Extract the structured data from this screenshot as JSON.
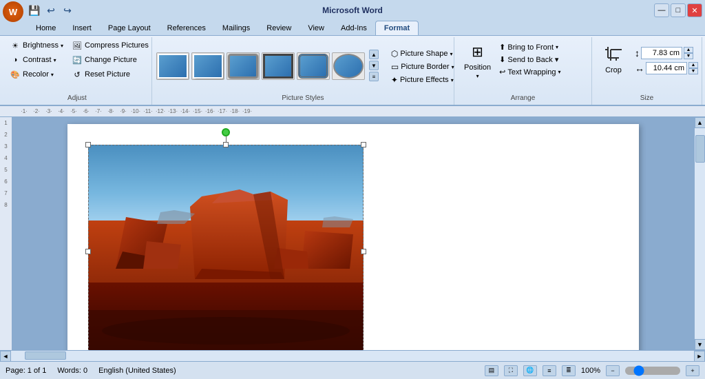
{
  "window": {
    "title": "Microsoft Word",
    "office_btn_label": "W"
  },
  "quick_access": {
    "save_label": "💾",
    "undo_label": "↩",
    "redo_label": "↪"
  },
  "tabs": [
    {
      "id": "home",
      "label": "Home"
    },
    {
      "id": "insert",
      "label": "Insert"
    },
    {
      "id": "page_layout",
      "label": "Page Layout"
    },
    {
      "id": "references",
      "label": "References"
    },
    {
      "id": "mailings",
      "label": "Mailings"
    },
    {
      "id": "review",
      "label": "Review"
    },
    {
      "id": "view",
      "label": "View"
    },
    {
      "id": "add_ins",
      "label": "Add-Ins"
    },
    {
      "id": "format",
      "label": "Format"
    }
  ],
  "ribbon": {
    "adjust": {
      "label": "Adjust",
      "brightness": "Brightness",
      "contrast": "Contrast",
      "recolor": "Recolor",
      "compress": "Compress Pictures",
      "change": "Change Picture",
      "reset": "Reset Picture"
    },
    "picture_styles": {
      "label": "Picture Styles",
      "more_label": "▼"
    },
    "picture_tools": {
      "shape_label": "Picture Shape",
      "border_label": "Picture Border",
      "effects_label": "Picture Effects"
    },
    "arrange": {
      "label": "Arrange",
      "position_label": "Position",
      "bring_front": "Bring to Front",
      "send_back": "Send to Back ▾",
      "text_wrapping": "Text Wrapping"
    },
    "size": {
      "label": "Size",
      "crop_label": "Crop",
      "height_label": "7.83 cm",
      "width_label": "10.44 cm",
      "height_icon": "↕",
      "width_icon": "↔"
    }
  },
  "status_bar": {
    "page": "Page: 1 of 1",
    "words": "Words: 0",
    "language": "English (United States)",
    "zoom": "100%"
  },
  "window_controls": {
    "minimize": "—",
    "maximize": "□",
    "close": "✕"
  }
}
